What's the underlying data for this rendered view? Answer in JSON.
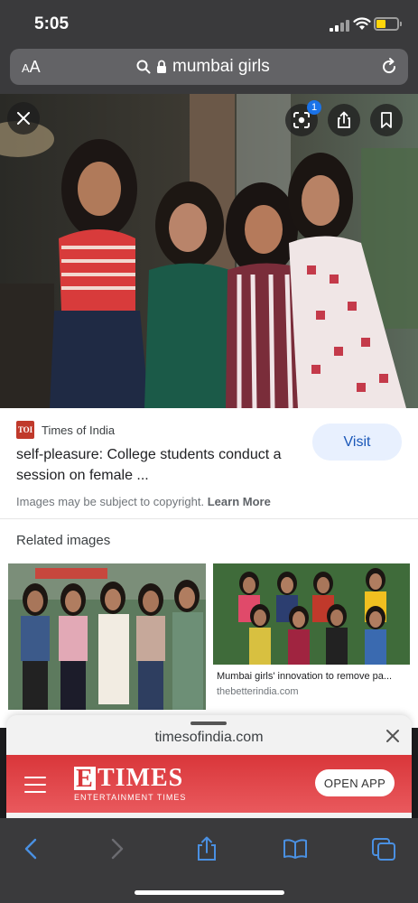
{
  "status_bar": {
    "time": "5:05"
  },
  "address_bar": {
    "aa_label": "AA",
    "url": "mumbai girls"
  },
  "hero": {
    "lens_badge_count": "1"
  },
  "result": {
    "source": "Times of India",
    "source_logo_text": "TOI",
    "title": "self-pleasure: College students conduct a session on female ...",
    "visit_label": "Visit",
    "copyright_text": "Images may be subject to copyright.",
    "learn_more": "Learn More"
  },
  "related": {
    "heading": "Related images",
    "items": [
      {
        "caption": "",
        "domain": ""
      },
      {
        "caption": "Mumbai girls' innovation to remove pa...",
        "domain": "thebetterindia.com"
      }
    ]
  },
  "preview_sheet": {
    "domain": "timesofindia.com",
    "logo_letter": "E",
    "logo_text": "TIMES",
    "logo_sub": "ENTERTAINMENT TIMES",
    "open_app_label": "OPEN APP"
  },
  "colors": {
    "accent_blue": "#1a73e8",
    "visit_bg": "#e8f0fe",
    "etimes_red": "#d9363a",
    "chrome_bg": "#3a3a3c",
    "toolbar_icon_blue": "#4a90e2"
  },
  "icons": [
    "signal-icon",
    "wifi-icon",
    "battery-icon",
    "search-icon",
    "lock-icon",
    "reload-icon",
    "close-icon",
    "lens-icon",
    "share-icon",
    "bookmark-icon",
    "menu-icon",
    "back-icon",
    "forward-icon",
    "books-icon",
    "tabs-icon"
  ]
}
